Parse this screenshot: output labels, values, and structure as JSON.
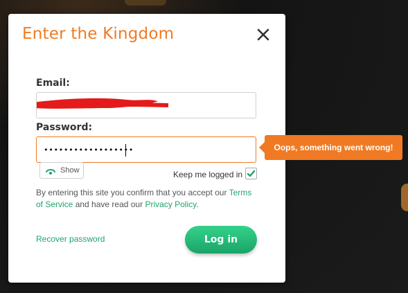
{
  "dialog": {
    "title": "Enter the Kingdom",
    "close_icon": "close-icon"
  },
  "email": {
    "label": "Email:",
    "value_redacted": true
  },
  "password": {
    "label": "Password:",
    "masked_value": "••••••••••••••••••",
    "error_message": "Oops, something went wrong!"
  },
  "show_toggle": {
    "label": "Show",
    "icon": "eye-icon"
  },
  "keep_logged_in": {
    "label": "Keep me logged in",
    "checked": true
  },
  "terms": {
    "prefix": "By entering this site you confirm that you accept our ",
    "terms_link": "Terms of Service",
    "middle": " and have read our ",
    "privacy_link": "Privacy Policy",
    "suffix": "."
  },
  "actions": {
    "recover_label": "Recover password",
    "login_label": "Log in"
  },
  "colors": {
    "accent_orange": "#f07a23",
    "accent_green": "#1fa46d"
  }
}
